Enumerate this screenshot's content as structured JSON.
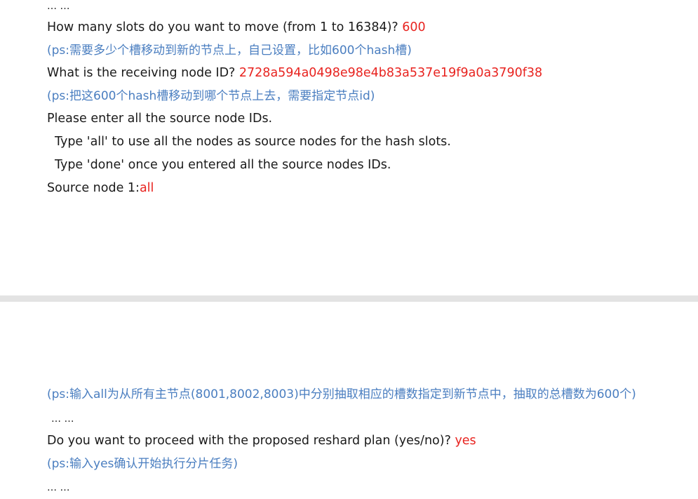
{
  "section1": {
    "ellipsis_top": "… …",
    "q_slots_prompt": "How many slots do you want to move (from 1 to 16384)? ",
    "q_slots_answer": "600",
    "note_slots": "(ps:需要多少个槽移动到新的节点上，自己设置，比如600个hash槽)",
    "q_node_prompt": "What is the receiving node ID? ",
    "q_node_answer": "2728a594a0498e98e4b83a537e19f9a0a3790f38",
    "note_node": "(ps:把这600个hash槽移动到哪个节点上去，需要指定节点id)",
    "source_prompt": "Please enter all the source node IDs.",
    "type_all": "Type 'all' to use all the nodes as source nodes for the hash slots.",
    "type_done": "Type 'done' once you entered all the source nodes IDs.",
    "source_node_prompt": "Source node 1:",
    "source_node_answer": "all"
  },
  "section2": {
    "note_all": "(ps:输入all为从所有主节点(8001,8002,8003)中分别抽取相应的槽数指定到新节点中，抽取的总槽数为600个)",
    "ellipsis_mid": "… …",
    "proceed_prompt": "Do you want to proceed with the proposed reshard plan (yes/no)? ",
    "proceed_answer": "yes",
    "note_yes": "(ps:输入yes确认开始执行分片任务)",
    "ellipsis_bottom": "… …"
  },
  "colors": {
    "answer": "#e8231f",
    "note": "#4a7ec0",
    "separator": "#e3e3e3"
  }
}
